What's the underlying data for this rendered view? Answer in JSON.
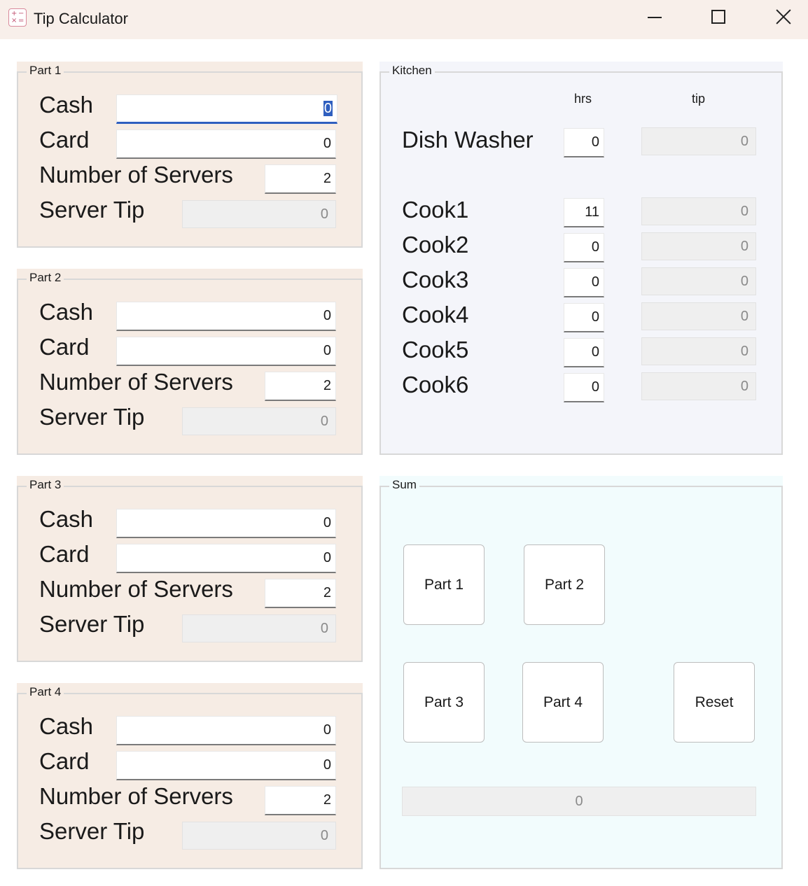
{
  "window": {
    "title": "Tip Calculator",
    "controls": {
      "minimize": "minimize",
      "maximize": "maximize",
      "close": "close"
    }
  },
  "labels": {
    "cash": "Cash",
    "card": "Card",
    "servers": "Number of Servers",
    "server_tip": "Server Tip"
  },
  "parts": [
    {
      "legend": "Part 1",
      "cash": "0",
      "card": "0",
      "servers": "2",
      "server_tip": "0"
    },
    {
      "legend": "Part 2",
      "cash": "0",
      "card": "0",
      "servers": "2",
      "server_tip": "0"
    },
    {
      "legend": "Part 3",
      "cash": "0",
      "card": "0",
      "servers": "2",
      "server_tip": "0"
    },
    {
      "legend": "Part 4",
      "cash": "0",
      "card": "0",
      "servers": "2",
      "server_tip": "0"
    }
  ],
  "kitchen": {
    "legend": "Kitchen",
    "col_hrs": "hrs",
    "col_tip": "tip",
    "staff": [
      {
        "name": "Dish Washer",
        "hrs": "0",
        "tip": "0"
      },
      {
        "name": "Cook1",
        "hrs": "11",
        "tip": "0"
      },
      {
        "name": "Cook2",
        "hrs": "0",
        "tip": "0"
      },
      {
        "name": "Cook3",
        "hrs": "0",
        "tip": "0"
      },
      {
        "name": "Cook4",
        "hrs": "0",
        "tip": "0"
      },
      {
        "name": "Cook5",
        "hrs": "0",
        "tip": "0"
      },
      {
        "name": "Cook6",
        "hrs": "0",
        "tip": "0"
      }
    ]
  },
  "sum": {
    "legend": "Sum",
    "buttons": {
      "part1": "Part 1",
      "part2": "Part 2",
      "part3": "Part 3",
      "part4": "Part 4",
      "reset": "Reset"
    },
    "total": "0"
  }
}
